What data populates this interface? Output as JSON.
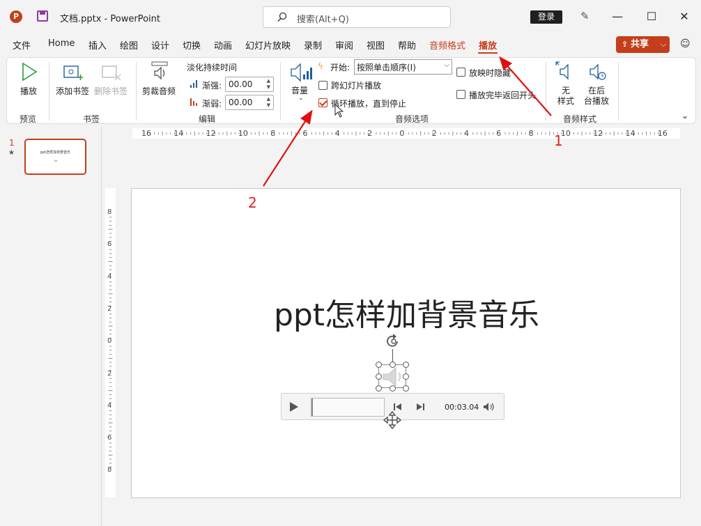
{
  "titlebar": {
    "app_icon_letter": "P",
    "title": "文档.pptx  -  PowerPoint",
    "search_placeholder": "搜索(Alt+Q)",
    "login": "登录"
  },
  "tabs": [
    {
      "label": "文件"
    },
    {
      "label": "Home"
    },
    {
      "label": "插入"
    },
    {
      "label": "绘图"
    },
    {
      "label": "设计"
    },
    {
      "label": "切换"
    },
    {
      "label": "动画"
    },
    {
      "label": "幻灯片放映"
    },
    {
      "label": "录制"
    },
    {
      "label": "审阅"
    },
    {
      "label": "视图"
    },
    {
      "label": "帮助"
    },
    {
      "label": "音频格式"
    },
    {
      "label": "播放"
    }
  ],
  "share_label": "共享",
  "ribbon": {
    "preview": {
      "button": "播放",
      "group": "预览"
    },
    "bookmark": {
      "add": "添加书签",
      "remove": "删除书签",
      "group": "书签"
    },
    "edit": {
      "trim": "剪裁音频",
      "fade_title": "淡化持续时间",
      "fade_in_label": "渐强:",
      "fade_in_value": "00.00",
      "fade_out_label": "渐弱:",
      "fade_out_value": "00.00",
      "group": "编辑"
    },
    "audio_options": {
      "volume": "音量",
      "start_label": "开始:",
      "start_value": "按照单击顺序(I)",
      "cross_slides": "跨幻灯片播放",
      "loop": "循环播放，直到停止",
      "hide": "放映时隐藏",
      "rewind": "播放完毕返回开头",
      "group": "音频选项",
      "cross_slides_checked": false,
      "loop_checked": true,
      "hide_checked": false,
      "rewind_checked": false
    },
    "audio_styles": {
      "no_style_1": "无",
      "no_style_2": "样式",
      "bg_1": "在后",
      "bg_2": "台播放",
      "group": "音频样式"
    }
  },
  "rulers": {
    "h_ticks": [
      "16",
      "14",
      "12",
      "10",
      "8",
      "6",
      "4",
      "2",
      "0",
      "2",
      "4",
      "6",
      "8",
      "10",
      "12",
      "14",
      "16"
    ],
    "v_ticks": [
      "8",
      "6",
      "4",
      "2",
      "0",
      "2",
      "4",
      "6",
      "8"
    ]
  },
  "thumbnail": {
    "number": "1",
    "star": "★",
    "title": "ppt怎样加背景音乐"
  },
  "slide": {
    "title": "ppt怎样加背景音乐"
  },
  "player": {
    "time": "00:03.04"
  },
  "annotations": {
    "one": "1",
    "two": "2"
  }
}
